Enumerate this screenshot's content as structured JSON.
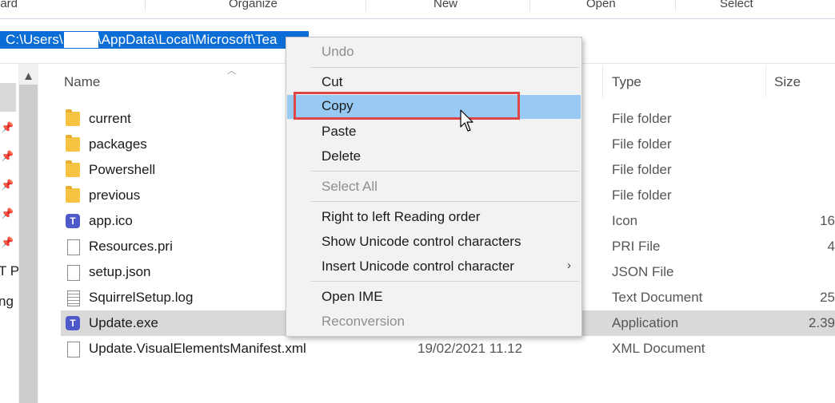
{
  "ribbon": {
    "groups": [
      "oard",
      "Organize",
      "New",
      "Open",
      "Select"
    ]
  },
  "address": {
    "part1": "C:\\Users\\",
    "part2": "\\AppData\\Local\\Microsoft\\Tea"
  },
  "nav": {
    "labels": [
      "T PF",
      "ng"
    ]
  },
  "columns": {
    "name": "Name",
    "type": "Type",
    "size": "Size"
  },
  "files": [
    {
      "name": "current",
      "date": "",
      "type": "File folder",
      "size": "",
      "icon": "folder-icon"
    },
    {
      "name": "packages",
      "date": "",
      "type": "File folder",
      "size": "",
      "icon": "folder-icon"
    },
    {
      "name": "Powershell",
      "date": "",
      "type": "File folder",
      "size": "",
      "icon": "folder-icon"
    },
    {
      "name": "previous",
      "date": "",
      "type": "File folder",
      "size": "",
      "icon": "folder-icon"
    },
    {
      "name": "app.ico",
      "date": "",
      "type": "Icon",
      "size": "16",
      "icon": "teams-icon"
    },
    {
      "name": "Resources.pri",
      "date": "",
      "type": "PRI File",
      "size": "4",
      "icon": "file-icon"
    },
    {
      "name": "setup.json",
      "date": "",
      "type": "JSON File",
      "size": "",
      "icon": "file-icon"
    },
    {
      "name": "SquirrelSetup.log",
      "date": "",
      "type": "Text Document",
      "size": "25",
      "icon": "log-icon"
    },
    {
      "name": "Update.exe",
      "date": "",
      "type": "Application",
      "size": "2.39",
      "icon": "teams-icon"
    },
    {
      "name": "Update.VisualElementsManifest.xml",
      "date": "19/02/2021 11.12",
      "type": "XML Document",
      "size": "",
      "icon": "file-icon"
    }
  ],
  "context_menu": {
    "undo": "Undo",
    "cut": "Cut",
    "copy": "Copy",
    "paste": "Paste",
    "delete": "Delete",
    "select_all": "Select All",
    "rtl": "Right to left Reading order",
    "show_unicode": "Show Unicode control characters",
    "insert_unicode": "Insert Unicode control character",
    "open_ime": "Open IME",
    "reconversion": "Reconversion",
    "submenu_arrow": "›"
  },
  "colors": {
    "selection": "#0b6dd6",
    "menu_hover": "#99c9f5",
    "highlight_box": "#e04545",
    "row_selected": "#d9d9d9"
  }
}
